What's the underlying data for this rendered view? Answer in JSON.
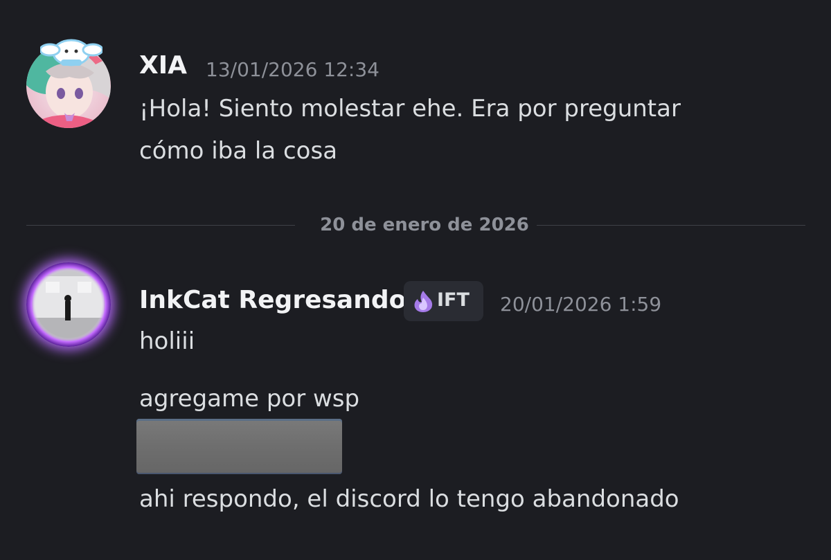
{
  "messages": [
    {
      "author": "XIA",
      "timestamp": "13/01/2026 12:34",
      "lines": [
        "¡Hola! Siento molestar ehe. Era por preguntar",
        "cómo iba la cosa"
      ]
    },
    {
      "author": "InkCat Regresando",
      "tag": "IFT",
      "timestamp": "20/01/2026 1:59",
      "lines": [
        "holiii",
        "agregame por wsp",
        "ahi respondo, el discord lo tengo abandonado"
      ]
    }
  ],
  "date_divider": "20 de enero de 2026",
  "colors": {
    "background": "#1c1d22",
    "username": "#f2f3f5",
    "message_text": "#dbdee1",
    "muted": "#8e9199",
    "avatar_glow": "#b86bff"
  },
  "icons": {
    "tag_icon": "purple-flame-icon"
  }
}
